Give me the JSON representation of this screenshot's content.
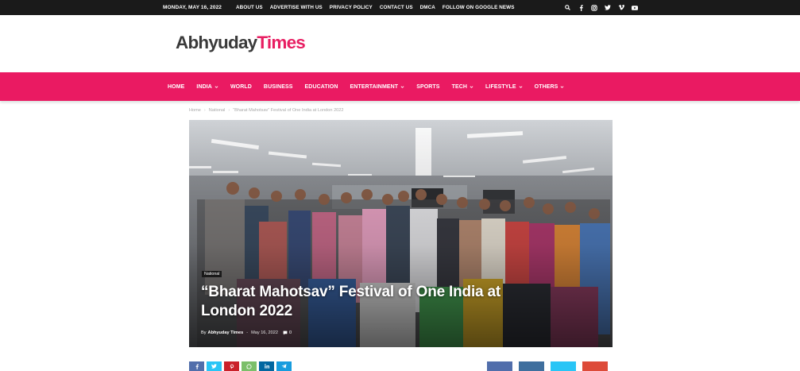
{
  "topbar": {
    "date": "MONDAY, MAY 16, 2022",
    "links": [
      "ABOUT US",
      "ADVERTISE WITH US",
      "PRIVACY POLICY",
      "CONTACT US",
      "DMCA",
      "FOLLOW ON GOOGLE NEWS"
    ],
    "icons": [
      "search-icon",
      "facebook-icon",
      "instagram-icon",
      "twitter-icon",
      "vimeo-icon",
      "youtube-icon"
    ]
  },
  "logo": {
    "part1": "Abhyuday",
    "part2": "Times"
  },
  "nav": {
    "items": [
      {
        "label": "HOME",
        "dropdown": false
      },
      {
        "label": "INDIA",
        "dropdown": true
      },
      {
        "label": "WORLD",
        "dropdown": false
      },
      {
        "label": "BUSINESS",
        "dropdown": false
      },
      {
        "label": "EDUCATION",
        "dropdown": false
      },
      {
        "label": "ENTERTAINMENT",
        "dropdown": true
      },
      {
        "label": "SPORTS",
        "dropdown": false
      },
      {
        "label": "TECH",
        "dropdown": true
      },
      {
        "label": "LIFESTYLE",
        "dropdown": true
      },
      {
        "label": "OTHERS",
        "dropdown": true
      }
    ]
  },
  "breadcrumb": {
    "items": [
      "Home",
      "National",
      "“Bharat Mahotsav” Festival of One India at London 2022"
    ],
    "separator": "›"
  },
  "article": {
    "category": "National",
    "title": "“Bharat Mahotsav” Festival of One India at London 2022",
    "by": "By",
    "author": "Abhyuday Times",
    "separator": "-",
    "date": "May 16, 2022",
    "comments": "0"
  },
  "share": {
    "left": [
      {
        "name": "facebook",
        "color": "#516eab"
      },
      {
        "name": "twitter",
        "color": "#29c5f6"
      },
      {
        "name": "pinterest",
        "color": "#ca212a"
      },
      {
        "name": "whatsapp",
        "color": "#7bbf6a"
      },
      {
        "name": "linkedin",
        "color": "#0266a0"
      },
      {
        "name": "telegram",
        "color": "#179cde"
      }
    ],
    "right": [
      {
        "name": "facebook",
        "color": "#516eab"
      },
      {
        "name": "linkedin",
        "color": "#3f6f9e"
      },
      {
        "name": "twitter",
        "color": "#29c5f6"
      },
      {
        "name": "pinterest",
        "color": "#dd4b39"
      }
    ]
  },
  "colors": {
    "accent": "#ea1a62",
    "topbar": "#1a1a1a",
    "logo_dark": "#3a3a3a",
    "logo_accent": "#e81e62"
  }
}
